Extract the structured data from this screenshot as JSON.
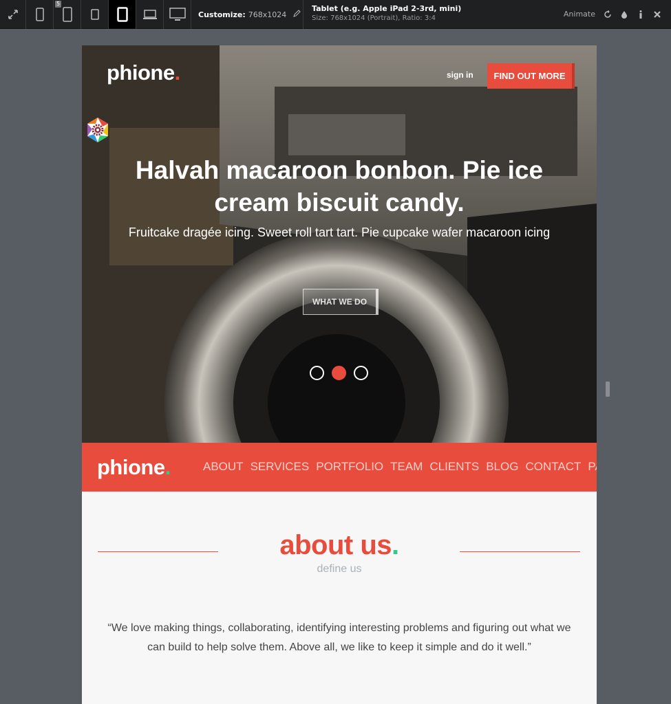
{
  "toolbar": {
    "badge": "5",
    "customize_label": "Customize:",
    "customize_value": "768x1024",
    "device_title": "Tablet (e.g. Apple iPad 2-3rd, mini)",
    "device_sub": "Size: 768x1024 (Portrait), Ratio: 3:4",
    "animate_label": "Animate",
    "icons": [
      "expand-icon",
      "phone-portrait-icon",
      "phone-landscape-icon",
      "tablet-small-icon",
      "tablet-icon",
      "laptop-icon",
      "desktop-icon",
      "pencil-icon",
      "rotate-icon",
      "drop-icon",
      "info-icon",
      "close-icon"
    ]
  },
  "hero": {
    "logo": "phione",
    "logo_dot": ".",
    "signin": "sign in",
    "cta": "FIND OUT MORE",
    "headline": "Halvah macaroon bonbon. Pie ice cream biscuit candy.",
    "subline": "Fruitcake dragée icing. Sweet roll tart tart. Pie cupcake wafer macaroon icing",
    "button": "WHAT WE DO",
    "slides": 3,
    "active_slide": 2
  },
  "nav": {
    "logo": "phione",
    "logo_dot": ".",
    "links": [
      "ABOUT",
      "SERVICES",
      "PORTFOLIO",
      "TEAM",
      "CLIENTS",
      "BLOG",
      "CONTACT",
      "PAGES"
    ]
  },
  "about": {
    "title": "about us",
    "title_dot": ".",
    "subtitle": "define us",
    "quote": "“We love making things, collaborating, identifying interesting problems and figuring out what we can build to help solve them. Above all, we like to keep it simple and do it well.”"
  },
  "colors": {
    "accent": "#e84c3d",
    "accent_dot": "#2ecc8a",
    "toolbar": "#1f2022",
    "backdrop": "#585c63"
  }
}
